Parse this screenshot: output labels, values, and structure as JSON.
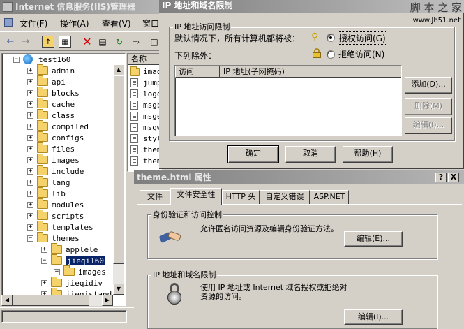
{
  "iis": {
    "title": "Internet 信息服务(IIS)管理器",
    "menu": [
      "文件(F)",
      "操作(A)",
      "查看(V)",
      "窗口"
    ],
    "tree": {
      "root": "test160",
      "items": [
        "admin",
        "api",
        "blocks",
        "cache",
        "class",
        "compiled",
        "configs",
        "files",
        "images",
        "include",
        "lang",
        "lib",
        "modules",
        "scripts",
        "templates",
        "themes"
      ],
      "themes_children": [
        "applele",
        "jieqi160"
      ],
      "jieqi160_children": [
        "images"
      ],
      "after": [
        "jieqidiv",
        "jieqistand"
      ]
    },
    "list": {
      "header": "名称",
      "items": [
        "imag",
        "jump",
        "logo",
        "msgb",
        "msge",
        "msgw",
        "styl",
        "them",
        "them"
      ]
    }
  },
  "ip_dialog": {
    "title": "IP 地址和域名限制",
    "group_label": "IP 地址访问限制",
    "default_text": "默认情况下，所有计算机都将被：",
    "grant_label": "授权访问(G)",
    "deny_label": "拒绝访问(N)",
    "except_text": "下列除外：",
    "col_access": "访问",
    "col_ip": "IP 地址(子网掩码)",
    "add_button": "添加(D)...",
    "remove_button": "删除(M)",
    "edit_button": "编辑(I)...",
    "ok_button": "确定",
    "cancel_button": "取消",
    "help_button": "帮助(H)",
    "watermark": "脚 本 之 家",
    "watermark_url": "www.Jb51.net"
  },
  "prop_window": {
    "title": "theme.html 属性",
    "help_btn": "?",
    "close_btn": "X",
    "tabs": [
      "文件",
      "文件安全性",
      "HTTP 头",
      "自定义错误",
      "ASP.NET"
    ],
    "active_tab": "文件安全性",
    "auth_group": "身份验证和访问控制",
    "auth_text": "允许匿名访问资源及编辑身份验证方法。",
    "auth_edit": "编辑(E)...",
    "ip_group": "IP 地址和域名限制",
    "ip_text": "使用 IP 地址或 Internet 域名授权或拒绝对资源的访问。",
    "ip_edit": "编辑(I)..."
  }
}
